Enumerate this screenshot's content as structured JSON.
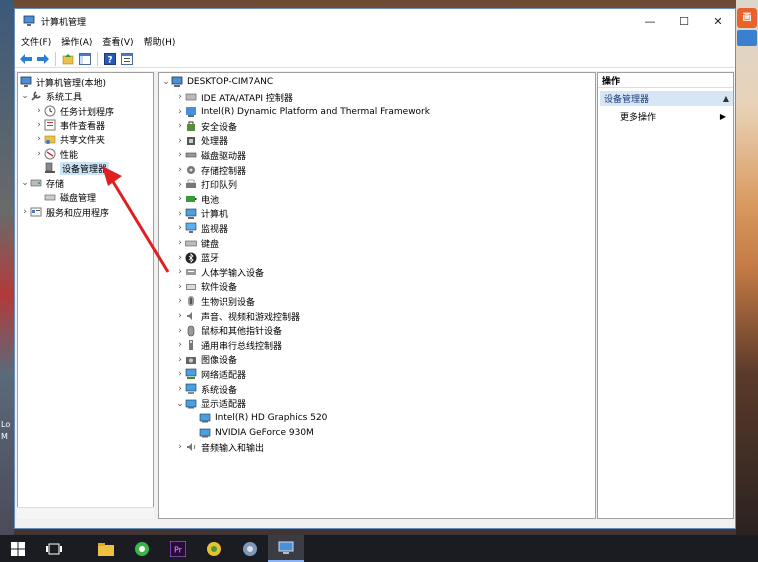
{
  "window": {
    "title": "计算机管理",
    "controls": {
      "minimize": "—",
      "maximize": "☐",
      "close": "✕"
    }
  },
  "menu": [
    "文件(F)",
    "操作(A)",
    "查看(V)",
    "帮助(H)"
  ],
  "left_tree": [
    {
      "label": "计算机管理(本地)",
      "level": 0,
      "chev": "",
      "icon": "computer-management-icon"
    },
    {
      "label": "系统工具",
      "level": 1,
      "chev": "⌄",
      "icon": "tools-icon"
    },
    {
      "label": "任务计划程序",
      "level": 2,
      "chev": "›",
      "icon": "clock-icon"
    },
    {
      "label": "事件查看器",
      "level": 2,
      "chev": "›",
      "icon": "event-viewer-icon"
    },
    {
      "label": "共享文件夹",
      "level": 2,
      "chev": "›",
      "icon": "shared-folder-icon"
    },
    {
      "label": "性能",
      "level": 2,
      "chev": "›",
      "icon": "performance-icon"
    },
    {
      "label": "设备管理器",
      "level": 2,
      "chev": "",
      "icon": "device-manager-icon",
      "selected": true
    },
    {
      "label": "存储",
      "level": 1,
      "chev": "⌄",
      "icon": "storage-icon"
    },
    {
      "label": "磁盘管理",
      "level": 2,
      "chev": "",
      "icon": "disk-management-icon"
    },
    {
      "label": "服务和应用程序",
      "level": 1,
      "chev": "›",
      "icon": "services-icon"
    }
  ],
  "device_tree": {
    "root": "DESKTOP-CIM7ANC",
    "items": [
      {
        "label": "IDE ATA/ATAPI 控制器",
        "chev": "›",
        "icon": "ide-controller-icon"
      },
      {
        "label": "Intel(R) Dynamic Platform and Thermal Framework",
        "chev": "›",
        "icon": "intel-platform-icon"
      },
      {
        "label": "安全设备",
        "chev": "›",
        "icon": "security-device-icon"
      },
      {
        "label": "处理器",
        "chev": "›",
        "icon": "processor-icon"
      },
      {
        "label": "磁盘驱动器",
        "chev": "›",
        "icon": "disk-drive-icon"
      },
      {
        "label": "存储控制器",
        "chev": "›",
        "icon": "storage-controller-icon"
      },
      {
        "label": "打印队列",
        "chev": "›",
        "icon": "printer-icon"
      },
      {
        "label": "电池",
        "chev": "›",
        "icon": "battery-icon"
      },
      {
        "label": "计算机",
        "chev": "›",
        "icon": "computer-icon"
      },
      {
        "label": "监视器",
        "chev": "›",
        "icon": "monitor-icon"
      },
      {
        "label": "键盘",
        "chev": "›",
        "icon": "keyboard-icon"
      },
      {
        "label": "蓝牙",
        "chev": "›",
        "icon": "bluetooth-icon"
      },
      {
        "label": "人体学输入设备",
        "chev": "›",
        "icon": "hid-icon"
      },
      {
        "label": "软件设备",
        "chev": "›",
        "icon": "software-device-icon"
      },
      {
        "label": "生物识别设备",
        "chev": "›",
        "icon": "biometric-icon"
      },
      {
        "label": "声音、视频和游戏控制器",
        "chev": "›",
        "icon": "audio-icon"
      },
      {
        "label": "鼠标和其他指针设备",
        "chev": "›",
        "icon": "mouse-icon"
      },
      {
        "label": "通用串行总线控制器",
        "chev": "›",
        "icon": "usb-icon"
      },
      {
        "label": "图像设备",
        "chev": "›",
        "icon": "camera-icon"
      },
      {
        "label": "网络适配器",
        "chev": "›",
        "icon": "network-adapter-icon"
      },
      {
        "label": "系统设备",
        "chev": "›",
        "icon": "system-device-icon"
      },
      {
        "label": "显示适配器",
        "chev": "⌄",
        "icon": "display-adapter-icon"
      },
      {
        "label": "Intel(R) HD Graphics 520",
        "chev": "",
        "icon": "display-adapter-icon",
        "child": true
      },
      {
        "label": "NVIDIA GeForce 930M",
        "chev": "",
        "icon": "display-adapter-icon",
        "child": true
      },
      {
        "label": "音频输入和输出",
        "chev": "›",
        "icon": "audio-io-icon"
      }
    ]
  },
  "actions": {
    "header": "操作",
    "section": "设备管理器",
    "item": "更多操作"
  },
  "annotation": {
    "color": "#e02020"
  },
  "colors": {
    "selection": "#cce4f7",
    "accent": "#1e3a78"
  }
}
